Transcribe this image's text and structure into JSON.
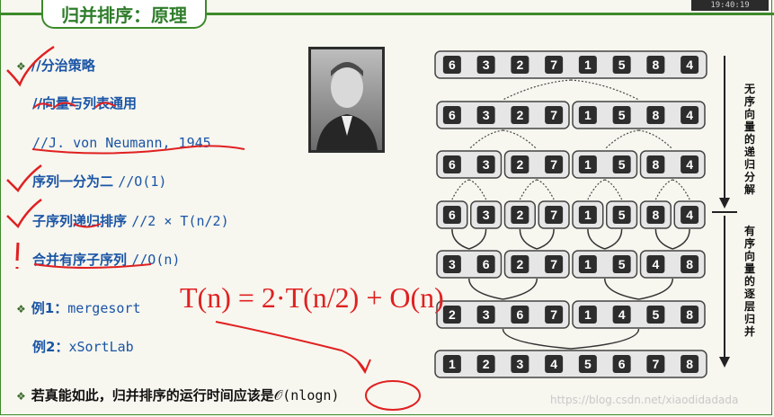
{
  "header": {
    "title": "归并排序：原理",
    "clock": "19:40:19"
  },
  "lines": {
    "l1": "//分治策略",
    "l2": "//向量与列表通用",
    "l3": "//J. von Neumann, 1945",
    "l4a": "序列一分为二",
    "l4b": "//O(1)",
    "l5a": "子序列递归排序",
    "l5b": "//2 × T(n/2)",
    "l6a": "合并有序子序列",
    "l6b": "//O(n)",
    "l7a": "例1：",
    "l7b": "mergesort",
    "l8a": "例2：",
    "l8b": "xSortLab",
    "l9a": "若真能如此，归并排序的运行时间应该是",
    "l9b": "𝒪(nlogn)"
  },
  "handwriting": {
    "formula": "T(n) = 2·T(n/2) + O(n)"
  },
  "side_labels": {
    "divide": "无序向量的递归分解",
    "merge": "有序向量的逐层归并"
  },
  "rows": [
    [
      [
        6,
        3,
        2,
        7,
        1,
        5,
        8,
        4
      ]
    ],
    [
      [
        6,
        3,
        2,
        7
      ],
      [
        1,
        5,
        8,
        4
      ]
    ],
    [
      [
        6,
        3
      ],
      [
        2,
        7
      ],
      [
        1,
        5
      ],
      [
        8,
        4
      ]
    ],
    [
      [
        6
      ],
      [
        3
      ],
      [
        2
      ],
      [
        7
      ],
      [
        1
      ],
      [
        5
      ],
      [
        8
      ],
      [
        4
      ]
    ],
    [
      [
        3,
        6
      ],
      [
        2,
        7
      ],
      [
        1,
        5
      ],
      [
        4,
        8
      ]
    ],
    [
      [
        2,
        3,
        6,
        7
      ],
      [
        1,
        4,
        5,
        8
      ]
    ],
    [
      [
        1,
        2,
        3,
        4,
        5,
        6,
        7,
        8
      ]
    ]
  ],
  "watermark": "https://blog.csdn.net/xiaodidadada"
}
